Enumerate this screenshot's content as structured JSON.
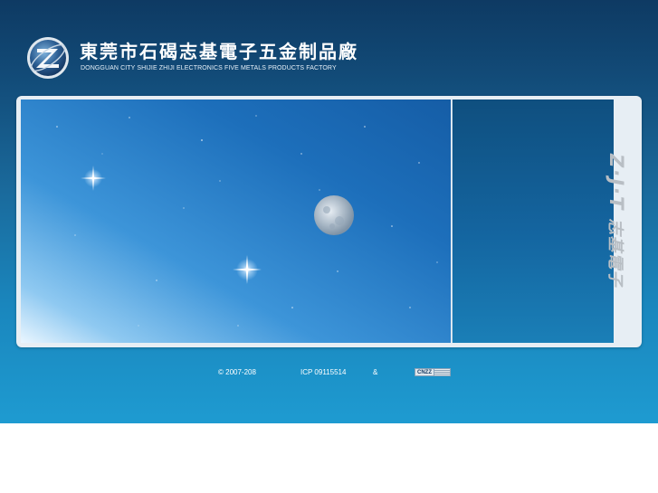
{
  "header": {
    "logo_icon": "zj-globe-logo-icon",
    "company_name_cn": "東莞市石碣志基電子五金制品廠",
    "company_name_en": "DONGGUAN CITY SHIJIE ZHIJI ELECTRONICS FIVE METALS PRODUCTS FACTORY"
  },
  "side_brand": {
    "latin": "Z·J·T",
    "cn": "志基電子"
  },
  "footer": {
    "copyright": "© 2007-208",
    "icp": "ICP 09115514",
    "ampersand": "&",
    "badge_label": "CNZZ"
  },
  "colors": {
    "header_bg": "#0e3a63",
    "footer_bg": "#1e9bd1",
    "frame": "#e7eef4"
  }
}
